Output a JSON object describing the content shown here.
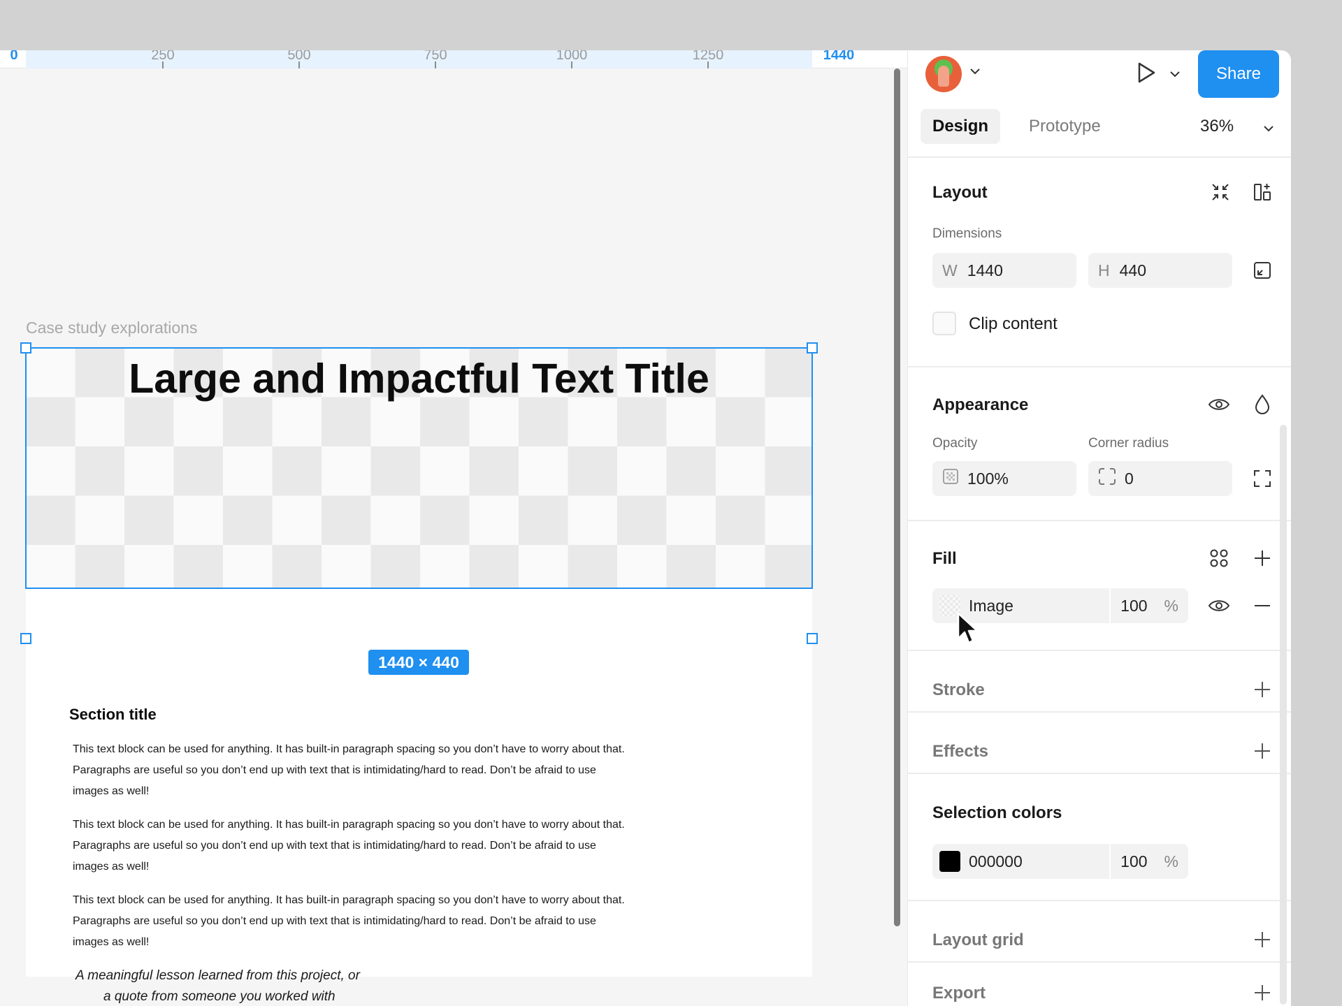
{
  "ruler": {
    "ticks": [
      "0",
      "250",
      "500",
      "750",
      "1000",
      "1250",
      "1440"
    ]
  },
  "canvas": {
    "frame_label": "Case study explorations",
    "hero_title": "Large and Impactful Text Title",
    "size_badge": "1440 × 440",
    "section_title": "Section title",
    "paragraphs": [
      "This text block can be used for anything. It has built-in paragraph spacing so you don’t have to worry about that. Paragraphs are useful so you don’t end up with text that is intimidating/hard to read. Don’t be afraid to use images as well!",
      "This text block can be used for anything. It has built-in paragraph spacing so you don’t have to worry about that. Paragraphs are useful so you don’t end up with text that is intimidating/hard to read. Don’t be afraid to use images as well!",
      "This text block can be used for anything. It has built-in paragraph spacing so you don’t have to worry about that. Paragraphs are useful so you don’t end up with text that is intimidating/hard to read. Don’t be afraid to use images as well!"
    ],
    "quote_line1": "A meaningful lesson learned from this project, or",
    "quote_line2": "a quote from someone you worked with"
  },
  "topbar": {
    "share_label": "Share",
    "icons": [
      "avatar",
      "chevron-down-icon",
      "play-icon",
      "chevron-down-icon"
    ]
  },
  "tabs": {
    "design": "Design",
    "prototype": "Prototype",
    "zoom": "36%"
  },
  "layout": {
    "title": "Layout",
    "dimensions_label": "Dimensions",
    "w_prefix": "W",
    "w_value": "1440",
    "h_prefix": "H",
    "h_value": "440",
    "clip_label": "Clip content"
  },
  "appearance": {
    "title": "Appearance",
    "opacity_label": "Opacity",
    "opacity_value": "100%",
    "radius_label": "Corner radius",
    "radius_value": "0"
  },
  "fill": {
    "title": "Fill",
    "type": "Image",
    "opacity": "100",
    "unit": "%"
  },
  "stroke": {
    "title": "Stroke"
  },
  "effects": {
    "title": "Effects"
  },
  "selection_colors": {
    "title": "Selection colors",
    "hex": "000000",
    "opacity": "100",
    "unit": "%",
    "swatch_color": "#000000"
  },
  "layout_grid": {
    "title": "Layout grid"
  },
  "export": {
    "title": "Export"
  },
  "colors": {
    "accent": "#1f8ff0"
  }
}
